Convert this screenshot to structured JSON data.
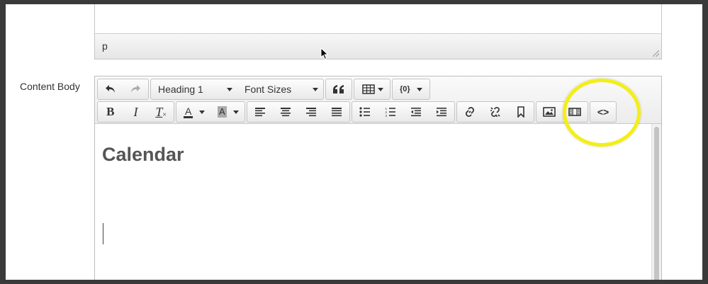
{
  "previous_editor": {
    "status_path": "p"
  },
  "form": {
    "content_label": "Content Body"
  },
  "toolbar": {
    "row1": {
      "undo": "undo-icon",
      "redo": "redo-icon",
      "format_select": "Heading 1",
      "font_size_select": "Font Sizes",
      "blockquote": "blockquote-icon",
      "table": "table-icon",
      "template": "{0}"
    },
    "row2": {
      "bold": "B",
      "italic": "I",
      "clear_format": "T",
      "text_color": "A",
      "bg_color": "A",
      "source_code": "<>"
    }
  },
  "content": {
    "heading": "Calendar"
  },
  "colors": {
    "highlight": "#f3ee1a",
    "heading": "#555555"
  }
}
